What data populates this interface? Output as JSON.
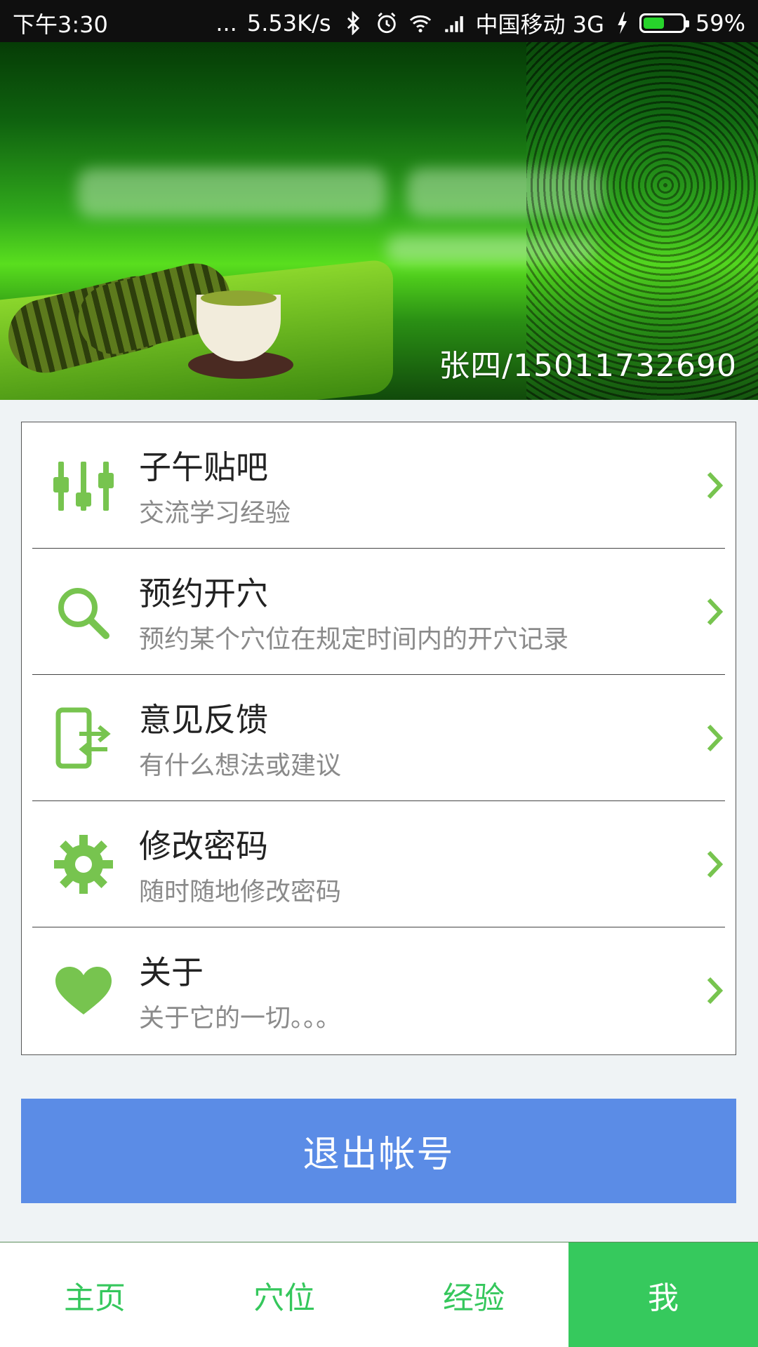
{
  "status_bar": {
    "time": "下午3:30",
    "dots": "...",
    "speed": "5.53K/s",
    "carrier": "中国移动 3G",
    "battery_percent": "59%",
    "battery_level": 0.59
  },
  "header": {
    "user_label": "张四/15011732690"
  },
  "menu": {
    "items": [
      {
        "title": "子午贴吧",
        "subtitle": "交流学习经验",
        "icon": "sliders-icon"
      },
      {
        "title": "预约开穴",
        "subtitle": "预约某个穴位在规定时间内的开穴记录",
        "icon": "search-icon"
      },
      {
        "title": "意见反馈",
        "subtitle": "有什么想法或建议",
        "icon": "phone-exchange-icon"
      },
      {
        "title": "修改密码",
        "subtitle": "随时随地修改密码",
        "icon": "gear-icon"
      },
      {
        "title": "关于",
        "subtitle": "关于它的一切。。。",
        "icon": "heart-icon"
      }
    ]
  },
  "logout_button": {
    "label": "退出帐号"
  },
  "tabs": [
    {
      "label": "主页",
      "active": false
    },
    {
      "label": "穴位",
      "active": false
    },
    {
      "label": "经验",
      "active": false
    },
    {
      "label": "我",
      "active": true
    }
  ],
  "colors": {
    "accent_green": "#77c44f",
    "tab_green": "#36c95d",
    "logout_blue": "#5b8ce6"
  }
}
